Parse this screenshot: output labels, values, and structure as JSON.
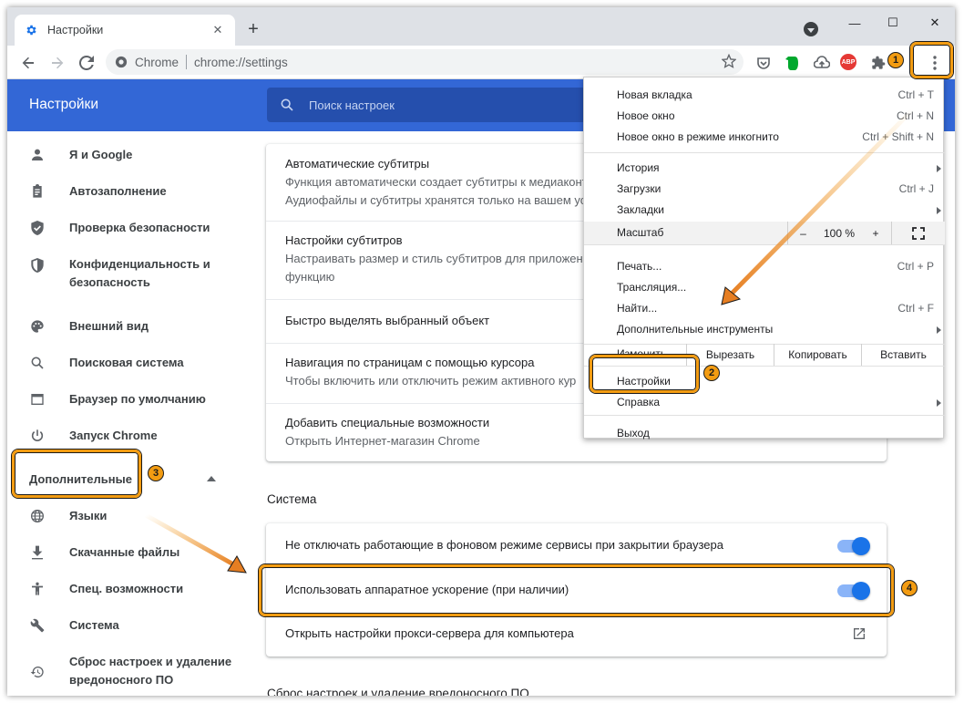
{
  "tab": {
    "title": "Настройки",
    "close": "✕",
    "new_tab": "+"
  },
  "window_controls": {
    "minimize": "—",
    "maximize": "☐",
    "close": "✕"
  },
  "omnibox": {
    "site": "Chrome",
    "url": "chrome://settings"
  },
  "extensions": {
    "abp": "ABP"
  },
  "header": {
    "title": "Настройки",
    "search_placeholder": "Поиск настроек"
  },
  "sidebar": {
    "items": [
      {
        "label": "Я и Google",
        "icon": "person-icon"
      },
      {
        "label": "Автозаполнение",
        "icon": "clipboard-icon"
      },
      {
        "label": "Проверка безопасности",
        "icon": "shield-check-icon"
      },
      {
        "label": "Конфиденциальность и безопасность",
        "icon": "shield-icon"
      },
      {
        "label": "Внешний вид",
        "icon": "palette-icon"
      },
      {
        "label": "Поисковая система",
        "icon": "search-icon"
      },
      {
        "label": "Браузер по умолчанию",
        "icon": "browser-icon"
      },
      {
        "label": "Запуск Chrome",
        "icon": "power-icon"
      }
    ],
    "advanced_label": "Дополнительные",
    "advanced_items": [
      {
        "label": "Языки",
        "icon": "globe-icon"
      },
      {
        "label": "Скачанные файлы",
        "icon": "download-icon"
      },
      {
        "label": "Спец. возможности",
        "icon": "accessibility-icon"
      },
      {
        "label": "Система",
        "icon": "wrench-icon"
      },
      {
        "label": "Сброс настроек и удаление вредоносного ПО",
        "icon": "restore-icon"
      }
    ]
  },
  "accessibility_card": {
    "rows": [
      {
        "title": "Автоматические субтитры",
        "line1": "Функция автоматически создает субтитры к медиаконтенту",
        "line2": "Аудиофайлы и субтитры хранятся только на вашем ус"
      },
      {
        "title": "Настройки субтитров",
        "line1": "Настраивать размер и стиль субтитров для приложений",
        "line2": "функцию"
      },
      {
        "title": "Быстро выделять выбранный объект"
      },
      {
        "title": "Навигация по страницам с помощью курсора",
        "line1": "Чтобы включить или отключить режим активного кур"
      },
      {
        "title": "Добавить специальные возможности",
        "line1": "Открыть Интернет-магазин Chrome"
      }
    ]
  },
  "system_section": {
    "title": "Система",
    "rows": [
      {
        "title": "Не отключать работающие в фоновом режиме сервисы при закрытии браузера",
        "enabled": true
      },
      {
        "title": "Использовать аппаратное ускорение (при наличии)",
        "enabled": true
      },
      {
        "title": "Открыть настройки прокси-сервера для компьютера"
      }
    ]
  },
  "next_section_cut": "Сброс настроек и удаление вредоносного ПО",
  "menu": {
    "group1": [
      {
        "label": "Новая вкладка",
        "shortcut": "Ctrl + T"
      },
      {
        "label": "Новое окно",
        "shortcut": "Ctrl + N"
      },
      {
        "label": "Новое окно в режиме инкогнито",
        "shortcut": "Ctrl + Shift + N"
      }
    ],
    "group2": [
      {
        "label": "История",
        "shortcut": ""
      },
      {
        "label": "Загрузки",
        "shortcut": "Ctrl + J"
      },
      {
        "label": "Закладки",
        "shortcut": ""
      }
    ],
    "zoom": {
      "label": "Масштаб",
      "minus": "–",
      "value": "100 %",
      "plus": "+"
    },
    "group3": [
      {
        "label": "Печать...",
        "shortcut": "Ctrl + P"
      },
      {
        "label": "Трансляция...",
        "shortcut": ""
      },
      {
        "label": "Найти...",
        "shortcut": "Ctrl + F"
      },
      {
        "label": "Дополнительные инструменты",
        "shortcut": ""
      }
    ],
    "edit": {
      "label": "Изменить",
      "cut": "Вырезать",
      "copy": "Копировать",
      "paste": "Вставить"
    },
    "group4": [
      {
        "label": "Настройки"
      },
      {
        "label": "Справка"
      }
    ],
    "exit": "Выход"
  },
  "annotations": {
    "b1": "1",
    "b2": "2",
    "b3": "3",
    "b4": "4"
  },
  "colors": {
    "header_blue": "#3367d6",
    "accent_orange": "#f39c12",
    "toggle_blue": "#1a73e8"
  }
}
